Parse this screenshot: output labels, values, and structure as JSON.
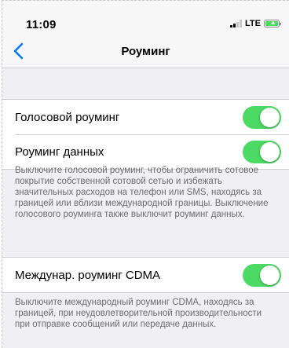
{
  "status_bar": {
    "time": "11:09",
    "network": "LTE"
  },
  "nav": {
    "title": "Роуминг",
    "back_icon": "chevron-left-icon"
  },
  "groups": [
    {
      "rows": [
        {
          "label": "Голосовой роуминг",
          "toggle_on": true
        },
        {
          "label": "Роуминг данных",
          "toggle_on": true
        }
      ],
      "footer": "Выключите голосовой роуминг, чтобы ограничить сотовое покрытие собственной сотовой сетью и избежать значительных расходов на телефон или SMS, находясь за границей или вблизи международной границы. Выключение голосового роуминга также выключит роуминг данных."
    },
    {
      "rows": [
        {
          "label": "Междунар. роуминг CDMA",
          "toggle_on": true
        }
      ],
      "footer": "Выключите международный роуминг CDMA, находясь за границей, при неудовлетворительной производительности при отправке сообщений или передаче данных."
    }
  ],
  "colors": {
    "accent": "#007aff",
    "toggle_on": "#4cd964",
    "background": "#efeff4",
    "footer_text": "#6d6d72"
  }
}
